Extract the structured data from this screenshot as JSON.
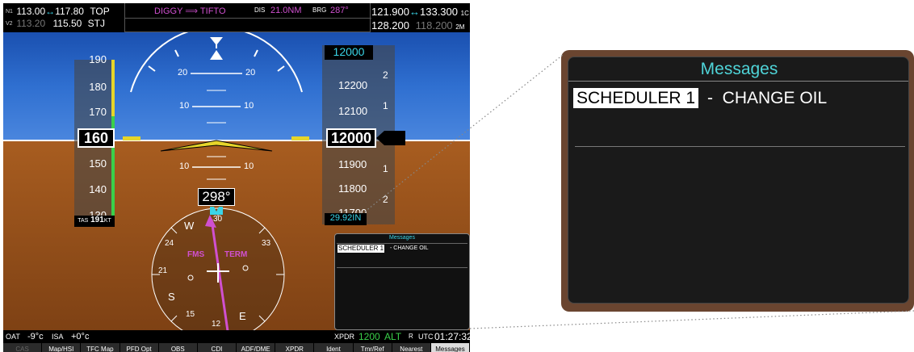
{
  "topbar": {
    "nav1_prefix": "N1",
    "nav1_active": "113.00",
    "nav1_arrow": "↔",
    "nav1_standby": "117.80",
    "nav1_ident": "TOP",
    "nav2_prefix": "V2",
    "nav2_active": "113.20",
    "nav2_standby": "115.50",
    "nav2_ident": "STJ",
    "active_leg": "DIGGY ⟹ TIFTO",
    "dis_label": "DIS",
    "dis_value": "21.0NM",
    "brg_label": "BRG",
    "brg_value": "287°",
    "com1_active": "121.900",
    "com1_arrow": "↔",
    "com1_standby": "133.300",
    "com1_label": "1C",
    "com2_active": "128.200",
    "com2_standby": "118.200",
    "com2_label": "2M"
  },
  "airspeed": {
    "ticks": [
      "190",
      "180",
      "170",
      "160",
      "150",
      "140",
      "130"
    ],
    "current": "160",
    "tas_label": "TAS",
    "tas_value": "191",
    "tas_unit": "KT"
  },
  "attitude": {
    "pitch_labels_up": [
      "20",
      "20",
      "10",
      "10"
    ],
    "pitch_labels_down": [
      "10",
      "10"
    ]
  },
  "altitude": {
    "selected": "12000",
    "ticks": [
      "12200",
      "12100",
      "11900",
      "11800",
      "11700"
    ],
    "current": "12000",
    "baro": "29.92IN",
    "vsi_ticks": [
      "2",
      "1",
      "1",
      "2"
    ]
  },
  "hsi": {
    "heading": "298°",
    "nav_source": "FMS",
    "phase": "TERM",
    "cardinal_labels": [
      "30",
      "W",
      "24",
      "21",
      "S",
      "15",
      "12",
      "E",
      "33"
    ]
  },
  "status": {
    "oat_label": "OAT",
    "oat_value": "-9°c",
    "isa_label": "ISA",
    "isa_value": "+0°c",
    "xpdr_label": "XPDR",
    "xpdr_code": "1200",
    "xpdr_mode": "ALT",
    "utc_marker": "R",
    "utc_label": "UTC",
    "utc_time": "01:27:32"
  },
  "softkeys": [
    "CAS",
    "Map/HSI",
    "TFC Map",
    "PFD Opt",
    "OBS",
    "CDI",
    "ADF/DME",
    "XPDR",
    "Ident",
    "Tmr/Ref",
    "Nearest",
    "Messages"
  ],
  "messages": {
    "title": "Messages",
    "highlighted": "SCHEDULER 1",
    "dash": "-",
    "text": "CHANGE OIL"
  },
  "colors": {
    "cyan": "#3ad5e8",
    "magenta": "#d050d0",
    "green": "#3ad04a",
    "sky": "#2f6fd0",
    "ground": "#8a4a18"
  }
}
